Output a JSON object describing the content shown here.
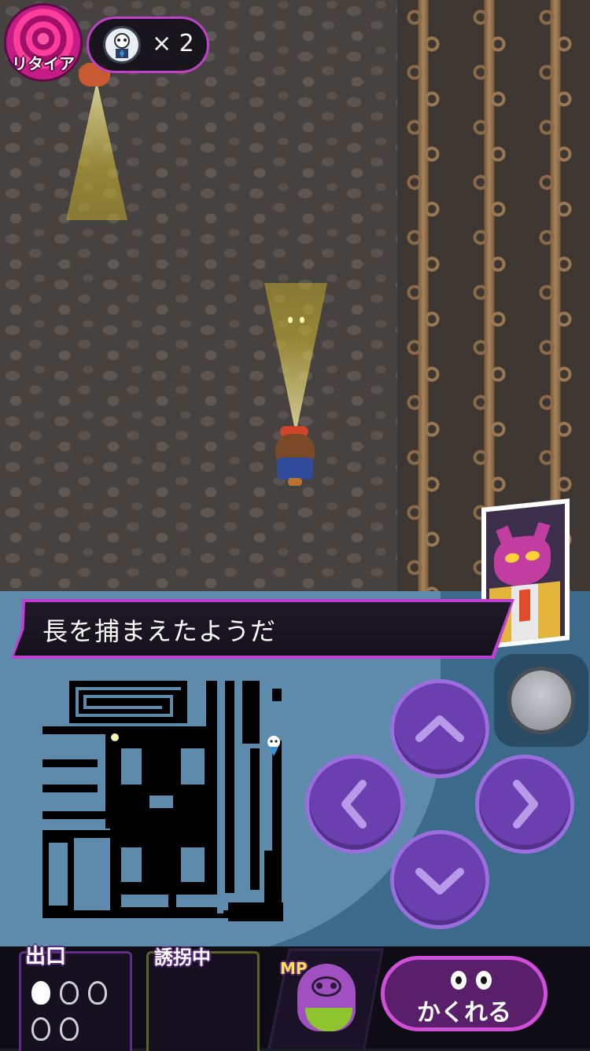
{
  "hud": {
    "retire_label": "リタイア",
    "lives_count": "× 2"
  },
  "dialog": {
    "message": "長を捕まえたようだ"
  },
  "controls": {
    "dpad": [
      "up",
      "left",
      "right",
      "down"
    ],
    "hide_label": "かくれる"
  },
  "status": {
    "exit_label": "出口",
    "exit_souls_total": 5,
    "exit_souls_filled": 1,
    "kidnapping_label": "誘拐中",
    "mp_label": "MP",
    "mp_level": 0.4
  },
  "colors": {
    "accent": "#c040c8",
    "panel": "#3b6a8a",
    "dpad": "#6b3fb0",
    "mp_fill": "#8ec42e"
  }
}
